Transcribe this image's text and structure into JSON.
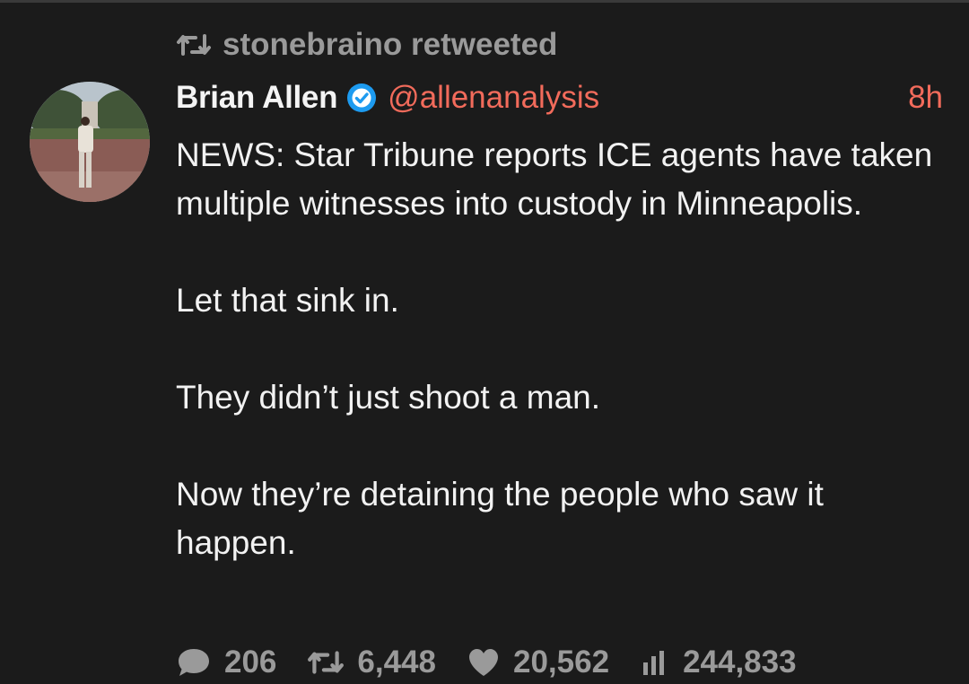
{
  "retweet_banner": {
    "icon": "retweet-icon",
    "text": "stonebraino retweeted"
  },
  "tweet": {
    "avatar": "profile-photo",
    "display_name": "Brian Allen",
    "verified_icon": "verified-badge-icon",
    "handle": "@allenanalysis",
    "time": "8h",
    "paragraphs": [
      "NEWS: Star Tribune reports ICE agents have taken multiple witnesses into custody in Minneapolis.",
      "Let that sink in.",
      "They didn’t just shoot a man.",
      "Now they’re detaining the people who saw it happen."
    ]
  },
  "actions": {
    "replies": "206",
    "retweets": "6,448",
    "likes": "20,562",
    "views": "244,833"
  },
  "colors": {
    "background": "#1b1b1b",
    "accent": "#f26b5b",
    "muted": "#9a9a9a",
    "verified": "#1d9bf0"
  }
}
